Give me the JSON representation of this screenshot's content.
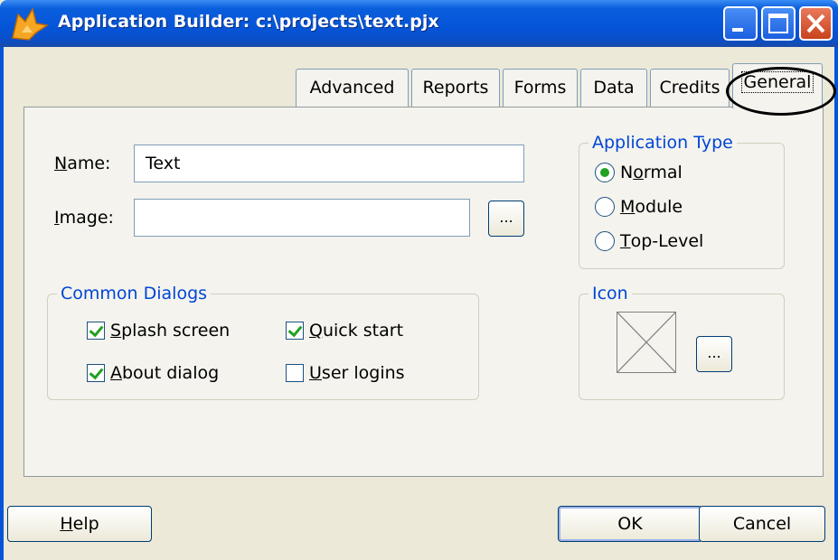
{
  "window": {
    "title": "Application Builder: c:\\projects\\text.pjx"
  },
  "tabs": [
    {
      "label": "Advanced"
    },
    {
      "label": "Reports"
    },
    {
      "label": "Forms"
    },
    {
      "label": "Data"
    },
    {
      "label": "Credits"
    },
    {
      "label": "General",
      "active": true
    }
  ],
  "general": {
    "name_label_u": "N",
    "name_label_rest": "ame:",
    "name_value": "Text",
    "image_label_u": "I",
    "image_label_rest": "mage:",
    "image_value": "",
    "browse_label": "...",
    "common_dialogs": {
      "title": "Common Dialogs",
      "splash": {
        "u": "S",
        "rest": "plash screen",
        "checked": true
      },
      "quick": {
        "u": "Q",
        "rest": "uick start",
        "checked": true
      },
      "about": {
        "u": "A",
        "rest": "bout dialog",
        "checked": true
      },
      "logins": {
        "u": "U",
        "rest": "ser logins",
        "checked": false
      }
    },
    "app_type": {
      "title": "Application Type",
      "normal": {
        "pre": "N",
        "u": "o",
        "rest": "rmal",
        "selected": true
      },
      "module": {
        "u": "M",
        "rest": "odule",
        "selected": false
      },
      "toplevel": {
        "u": "T",
        "rest": "op-Level",
        "selected": false
      }
    },
    "icon": {
      "title": "Icon",
      "browse_label": "..."
    }
  },
  "footer": {
    "help_u": "H",
    "help_rest": "elp",
    "ok": "OK",
    "cancel": "Cancel"
  },
  "colors": {
    "titlebar": "#0554d8",
    "group_title": "#0046d5",
    "check_mark": "#21a121"
  }
}
